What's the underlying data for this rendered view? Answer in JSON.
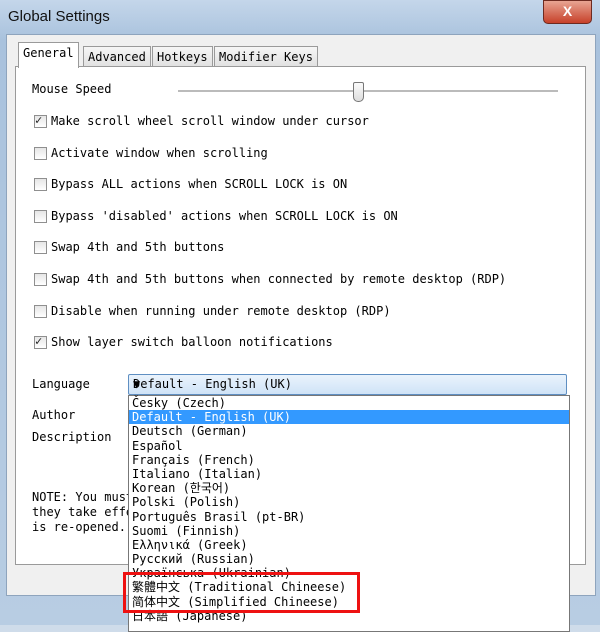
{
  "window": {
    "title": "Global Settings",
    "close_label": "X"
  },
  "tabs": [
    {
      "label": "General",
      "active": true
    },
    {
      "label": "Advanced"
    },
    {
      "label": "Hotkeys"
    },
    {
      "label": "Modifier Keys"
    }
  ],
  "mouse_speed": {
    "label": "Mouse Speed",
    "value_fraction": 0.47
  },
  "checkboxes": [
    {
      "label": "Make scroll wheel scroll window under cursor",
      "checked": true
    },
    {
      "label": "Activate window when scrolling",
      "checked": false
    },
    {
      "label": "Bypass ALL actions when SCROLL LOCK is ON",
      "checked": false
    },
    {
      "label": "Bypass 'disabled' actions when SCROLL LOCK is ON",
      "checked": false
    },
    {
      "label": "Swap 4th and 5th buttons",
      "checked": false
    },
    {
      "label": "Swap 4th and 5th buttons when connected by remote desktop (RDP)",
      "checked": false
    },
    {
      "label": "Disable when running under remote desktop (RDP)",
      "checked": false
    },
    {
      "label": "Show layer switch balloon notifications",
      "checked": true
    }
  ],
  "language": {
    "label": "Language",
    "selected": "Default - English (UK)",
    "options": [
      "Česky (Czech)",
      "Default - English (UK)",
      "Deutsch (German)",
      "Español",
      "Français (French)",
      "Italiano (Italian)",
      "Korean (한국어)",
      "Polski (Polish)",
      "Português Brasil (pt-BR)",
      "Suomi (Finnish)",
      "Ελληνικά (Greek)",
      "Русский (Russian)",
      "Українська (Ukrainian)",
      "繁體中文 (Traditional Chineese)",
      "简体中文 (Simplified Chineese)",
      "日本語 (Japanese)"
    ]
  },
  "author_label": "Author",
  "description_label": "Description",
  "note": "NOTE: You must\nthey take effe\nis re-opened."
}
